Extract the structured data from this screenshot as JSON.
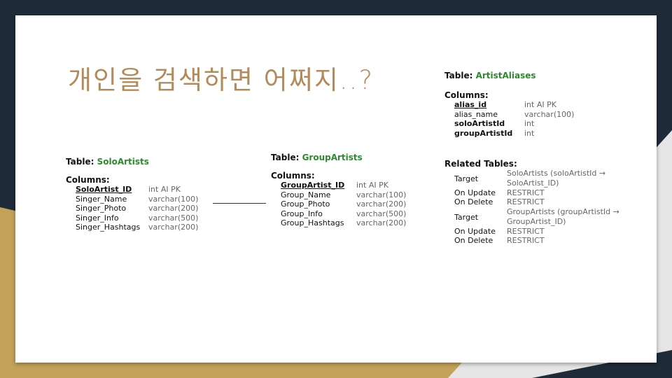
{
  "slide": {
    "title": "개인을 검색하면 어쩌지..?"
  },
  "solo_artists": {
    "table_label": "Table:",
    "table_name": "SoloArtists",
    "columns_label": "Columns:",
    "columns": [
      {
        "name": "SoloArtist_ID",
        "type": "int AI PK"
      },
      {
        "name": "Singer_Name",
        "type": "varchar(100)"
      },
      {
        "name": "Singer_Photo",
        "type": "varchar(200)"
      },
      {
        "name": "Singer_Info",
        "type": "varchar(500)"
      },
      {
        "name": "Singer_Hashtags",
        "type": "varchar(200)"
      }
    ]
  },
  "group_artists": {
    "table_label": "Table:",
    "table_name": "GroupArtists",
    "columns_label": "Columns:",
    "columns": [
      {
        "name": "GroupArtist_ID",
        "type": "int AI PK"
      },
      {
        "name": "Group_Name",
        "type": "varchar(100)"
      },
      {
        "name": "Group_Photo",
        "type": "varchar(200)"
      },
      {
        "name": "Group_Info",
        "type": "varchar(500)"
      },
      {
        "name": "Group_Hashtags",
        "type": "varchar(200)"
      }
    ]
  },
  "artist_aliases": {
    "table_label": "Table:",
    "table_name": "ArtistAliases",
    "columns_label": "Columns:",
    "columns": [
      {
        "name": "alias_id",
        "type": "int AI PK"
      },
      {
        "name": "alias_name",
        "type": "varchar(100)"
      },
      {
        "name": "soloArtistId",
        "type": "int"
      },
      {
        "name": "groupArtistId",
        "type": "int"
      }
    ],
    "related_label": "Related Tables:",
    "related": [
      {
        "target_label": "Target",
        "target_line1": "SoloArtists (soloArtistId →",
        "target_line2": "SoloArtist_ID)",
        "on_update_label": "On Update",
        "on_update": "RESTRICT",
        "on_delete_label": "On Delete",
        "on_delete": "RESTRICT"
      },
      {
        "target_label": "Target",
        "target_line1": "GroupArtists (groupArtistId →",
        "target_line2": "GroupArtist_ID)",
        "on_update_label": "On Update",
        "on_update": "RESTRICT",
        "on_delete_label": "On Delete",
        "on_delete": "RESTRICT"
      }
    ]
  },
  "colors": {
    "title": "#b38a5a",
    "table_name": "#2d8a2d",
    "background_dark": "#1f2b38",
    "accent_gold": "#c4a25a"
  }
}
